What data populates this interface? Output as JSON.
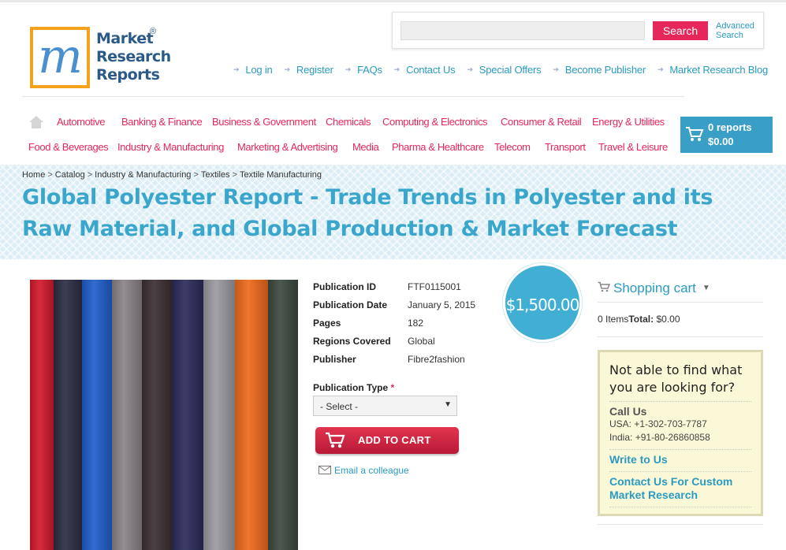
{
  "logo": {
    "line1": "Market",
    "line2": "Research",
    "line3": "Reports",
    "reg": "®"
  },
  "search": {
    "placeholder": "",
    "button": "Search",
    "advanced": "Advanced Search"
  },
  "topnav": [
    "Log in",
    "Register",
    "FAQs",
    "Contact Us",
    "Special Offers",
    "Become Publisher",
    "Market Research Blog"
  ],
  "categories_row1": [
    "Automotive",
    "Banking & Finance",
    "Business & Government",
    "Chemicals",
    "Computing & Electronics",
    "Consumer & Retail",
    "Energy & Utilities"
  ],
  "categories_row2": [
    "Food & Beverages",
    "Industry & Manufacturing",
    "Marketing & Advertising",
    "Media",
    "Pharma & Healthcare",
    "Telecom",
    "Transport",
    "Travel & Leisure"
  ],
  "cart_top": {
    "reports": "0 reports",
    "total": "$0.00"
  },
  "breadcrumb": [
    "Home",
    "Catalog",
    "Industry & Manufacturing",
    "Textiles",
    "Textile Manufacturing"
  ],
  "title": "Global Polyester Report - Trade Trends in Polyester and its Raw Material, and Global Production & Market Forecast",
  "details": [
    {
      "label": "Publication ID",
      "value": "FTF0115001"
    },
    {
      "label": "Publication Date",
      "value": "January 5, 2015"
    },
    {
      "label": "Pages",
      "value": "182"
    },
    {
      "label": "Regions Covered",
      "value": "Global"
    },
    {
      "label": "Publisher",
      "value": "Fibre2fashion"
    }
  ],
  "price": "$1,500.00",
  "publication_type": {
    "label": "Publication Type",
    "required": "*",
    "selected": "- Select -"
  },
  "add_to_cart": "ADD TO CART",
  "email_colleague": "Email a colleague",
  "shopping_cart": {
    "title": "Shopping cart",
    "items": "0 Items",
    "total_label": "Total:",
    "total": "$0.00"
  },
  "help": {
    "heading": "Not able to find what you are looking for?",
    "call_us": "Call Us",
    "usa": "USA: +1-302-703-7787",
    "india": "India: +91-80-26860858",
    "write": "Write to Us",
    "custom": "Contact Us For Custom Market Research"
  },
  "colors": {
    "accent_blue": "#2a9bc2",
    "accent_pink": "#e6275c",
    "price_circle": "#40afd3"
  },
  "fabric_colors": [
    "#d31a2c",
    "#2c2e44",
    "#1f5fcc",
    "#8a8388",
    "#3c3033",
    "#2b2c5c",
    "#9a9aa0",
    "#f06a1d",
    "#3e4a42"
  ]
}
